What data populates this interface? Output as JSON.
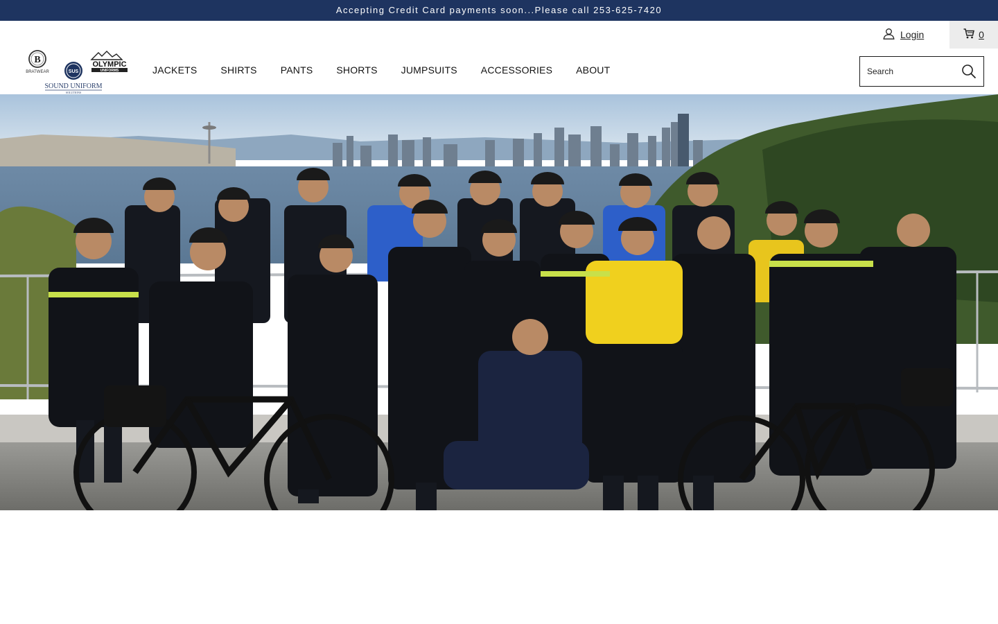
{
  "announcement": "Accepting Credit Card payments soon...Please call 253-625-7420",
  "brand": {
    "logo_line1": "BRATWEAR",
    "logo_b_letter": "B",
    "logo_olympic": "OLYMPIC",
    "logo_uniforms": "UNIFORMS",
    "logo_su": "SUS",
    "logo_main": "SOUND UNIFORM",
    "logo_sub": "SOLUTIONS"
  },
  "nav": {
    "items": [
      {
        "label": "JACKETS"
      },
      {
        "label": "SHIRTS"
      },
      {
        "label": "PANTS"
      },
      {
        "label": "SHORTS"
      },
      {
        "label": "JUMPSUITS"
      },
      {
        "label": "ACCESSORIES"
      },
      {
        "label": "ABOUT"
      }
    ]
  },
  "account": {
    "login_label": "Login",
    "login_icon": "user-icon",
    "cart_icon": "cart-icon",
    "cart_count": "0"
  },
  "search": {
    "placeholder": "Search",
    "icon": "search-icon"
  },
  "hero": {
    "alt": "Group of bike police officers posing in front of the Seattle skyline"
  },
  "colors": {
    "announce_bg": "#1e3460",
    "cart_bg": "#ececec",
    "text": "#1b1b1b"
  }
}
